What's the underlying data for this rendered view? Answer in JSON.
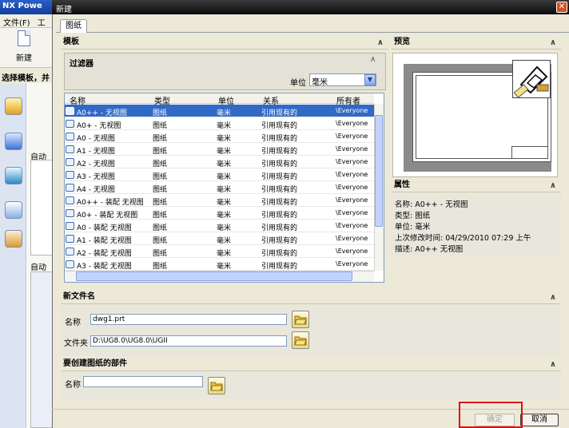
{
  "background_app": {
    "title": "NX Powe",
    "menu": [
      "文件(F)",
      "工"
    ],
    "new_label": "新建",
    "hint": "选择模板，并",
    "panel_labels": [
      "自动",
      "自动"
    ]
  },
  "dialog": {
    "title": "新建",
    "tab": "图纸",
    "templates_section": {
      "title": "模板",
      "filter": {
        "title": "过滤器",
        "unit_label": "单位",
        "unit_value": "毫米"
      },
      "columns": [
        "名称",
        "类型",
        "单位",
        "关系",
        "所有者"
      ],
      "rows": [
        {
          "name": "A0++ - 无视图",
          "type": "图纸",
          "unit": "毫米",
          "relation": "引用现有的",
          "owner": "\\Everyone",
          "selected": true
        },
        {
          "name": "A0+ - 无视图",
          "type": "图纸",
          "unit": "毫米",
          "relation": "引用现有的",
          "owner": "\\Everyone"
        },
        {
          "name": "A0 - 无视图",
          "type": "图纸",
          "unit": "毫米",
          "relation": "引用现有的",
          "owner": "\\Everyone"
        },
        {
          "name": "A1 - 无视图",
          "type": "图纸",
          "unit": "毫米",
          "relation": "引用现有的",
          "owner": "\\Everyone"
        },
        {
          "name": "A2 - 无视图",
          "type": "图纸",
          "unit": "毫米",
          "relation": "引用现有的",
          "owner": "\\Everyone"
        },
        {
          "name": "A3 - 无视图",
          "type": "图纸",
          "unit": "毫米",
          "relation": "引用现有的",
          "owner": "\\Everyone"
        },
        {
          "name": "A4 - 无视图",
          "type": "图纸",
          "unit": "毫米",
          "relation": "引用现有的",
          "owner": "\\Everyone"
        },
        {
          "name": "A0++ - 装配 无视图",
          "type": "图纸",
          "unit": "毫米",
          "relation": "引用现有的",
          "owner": "\\Everyone"
        },
        {
          "name": "A0+ - 装配 无视图",
          "type": "图纸",
          "unit": "毫米",
          "relation": "引用现有的",
          "owner": "\\Everyone"
        },
        {
          "name": "A0 - 装配 无视图",
          "type": "图纸",
          "unit": "毫米",
          "relation": "引用现有的",
          "owner": "\\Everyone"
        },
        {
          "name": "A1 - 装配 无视图",
          "type": "图纸",
          "unit": "毫米",
          "relation": "引用现有的",
          "owner": "\\Everyone"
        },
        {
          "name": "A2 - 装配 无视图",
          "type": "图纸",
          "unit": "毫米",
          "relation": "引用现有的",
          "owner": "\\Everyone"
        },
        {
          "name": "A3 - 装配 无视图",
          "type": "图纸",
          "unit": "毫米",
          "relation": "引用现有的",
          "owner": "\\Everyone"
        }
      ]
    },
    "preview_section": {
      "title": "预览"
    },
    "properties_section": {
      "title": "属性",
      "lines": [
        "名称:  A0++ - 无视图",
        "类型:  图纸",
        "单位:  毫米",
        "上次修改时间:  04/29/2010 07:29 上午",
        "描述:  A0++ 无视图"
      ]
    },
    "new_file_section": {
      "title": "新文件名",
      "name_label": "名称",
      "name_value": "dwg1.prt",
      "folder_label": "文件夹",
      "folder_value": "D:\\UG8.0\\UG8.0\\UGII"
    },
    "part_section": {
      "title": "要创建图纸的部件",
      "name_label": "名称",
      "name_value": ""
    },
    "buttons": {
      "ok": "确定",
      "cancel": "取消"
    }
  },
  "colors": {
    "selection": "#3169c6",
    "highlight_box": "#e01010"
  }
}
